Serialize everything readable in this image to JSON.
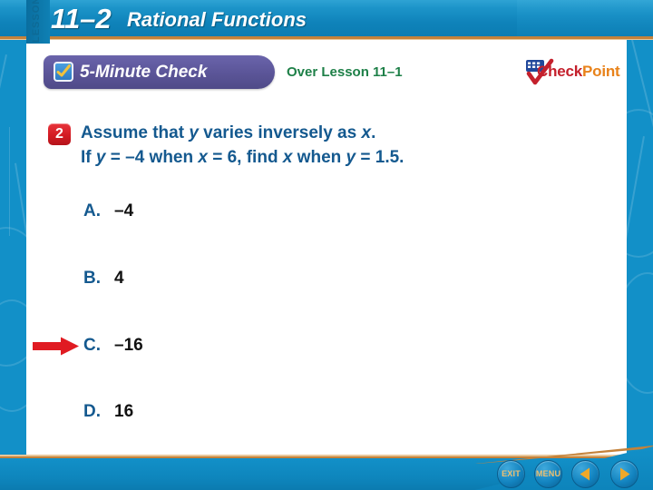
{
  "header": {
    "lesson_word": "LESSON",
    "lesson_number": "11–2",
    "title": "Rational Functions"
  },
  "check_banner": {
    "label": "5-Minute Check",
    "icon": "checkbox-check-icon"
  },
  "over_lesson": {
    "text": "Over Lesson 11–1"
  },
  "logo": {
    "check_word": "Check",
    "point_word": "Point",
    "flag_icon": "flag-icon",
    "check_icon": "red-checkmark-icon"
  },
  "question": {
    "number": "2",
    "line1_a": "Assume that ",
    "line1_y": "y",
    "line1_b": " varies inversely as ",
    "line1_x": "x",
    "line1_c": ".",
    "line2_a": "If ",
    "line2_y": "y",
    "line2_b": " = –4 when ",
    "line2_x": "x",
    "line2_c": " = 6, find ",
    "line2_x2": "x",
    "line2_d": " when ",
    "line2_y2": "y",
    "line2_e": " = 1.5."
  },
  "choices": [
    {
      "letter": "A.",
      "value": "–4"
    },
    {
      "letter": "B.",
      "value": "4"
    },
    {
      "letter": "C.",
      "value": "–16"
    },
    {
      "letter": "D.",
      "value": "16"
    }
  ],
  "answer_indicator": {
    "icon": "red-arrow-right-icon",
    "points_to": "C."
  },
  "footer": {
    "exit_label": "EXIT",
    "menu_label": "MENU",
    "back_icon": "triangle-left-icon",
    "next_icon": "triangle-right-icon"
  },
  "colors": {
    "header_blue": "#1290c8",
    "gold_line": "#c4823a",
    "banner_purple": "#5c5699",
    "question_blue": "#14598f",
    "over_green": "#1e8048",
    "badge_red": "#d31b23",
    "arrow_red": "#e01b22",
    "logo_red": "#c4202c",
    "logo_orange": "#e8821a"
  }
}
